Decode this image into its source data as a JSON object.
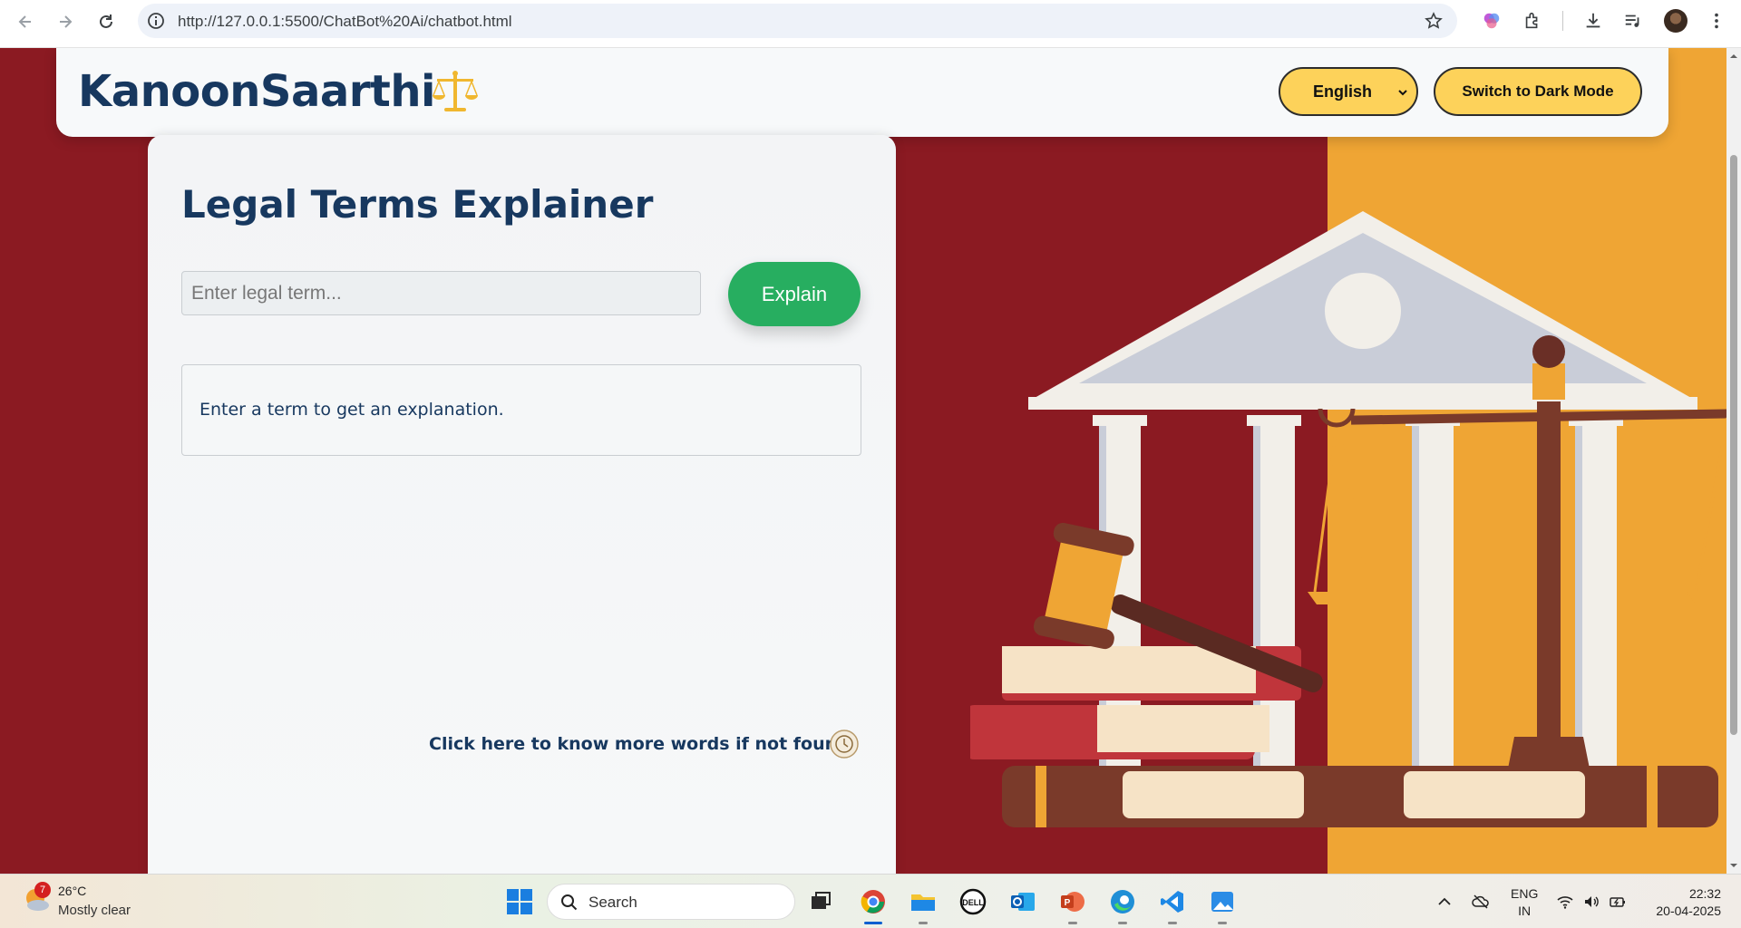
{
  "browser": {
    "url": "http://127.0.0.1:5500/ChatBot%20Ai/chatbot.html"
  },
  "header": {
    "brand": "KanoonSaarthi",
    "brand_icon": "balance-scale-icon",
    "language_selected": "English",
    "dark_mode_label": "Switch to Dark Mode"
  },
  "main": {
    "title": "Legal Terms Explainer",
    "input_placeholder": "Enter legal term...",
    "explain_label": "Explain",
    "result_text": "Enter a term to get an explanation.",
    "more_words_label": "Click here to know more words if not found:"
  },
  "taskbar": {
    "weather_badge": "7",
    "temperature": "26°C",
    "condition": "Mostly clear",
    "search_label": "Search",
    "lang_line1": "ENG",
    "lang_line2": "IN",
    "time": "22:32",
    "date": "20-04-2025"
  },
  "colors": {
    "brand_navy": "#17385f",
    "bg_maroon": "#8b1a22",
    "bg_orange": "#efa534",
    "button_yellow": "#fdd25a",
    "explain_green": "#27ae60"
  }
}
